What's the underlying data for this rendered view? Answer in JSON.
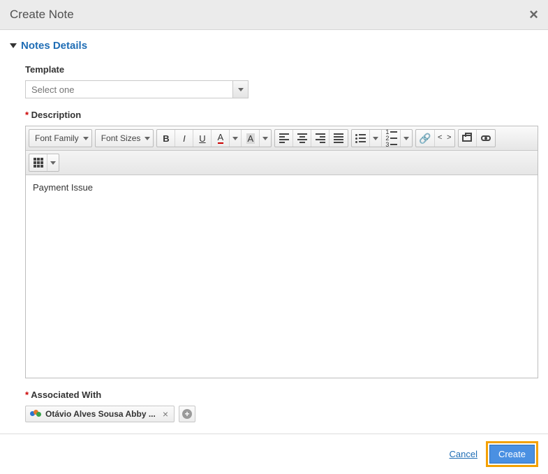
{
  "header": {
    "title": "Create Note"
  },
  "section": {
    "title": "Notes Details"
  },
  "template": {
    "label": "Template",
    "placeholder": "Select one"
  },
  "description": {
    "label": "Description",
    "content": "Payment Issue"
  },
  "toolbar": {
    "font_family": "Font Family",
    "font_sizes": "Font Sizes"
  },
  "associated": {
    "label": "Associated With",
    "chip": "Otávio Alves Sousa Abby ..."
  },
  "footer": {
    "cancel": "Cancel",
    "create": "Create"
  }
}
